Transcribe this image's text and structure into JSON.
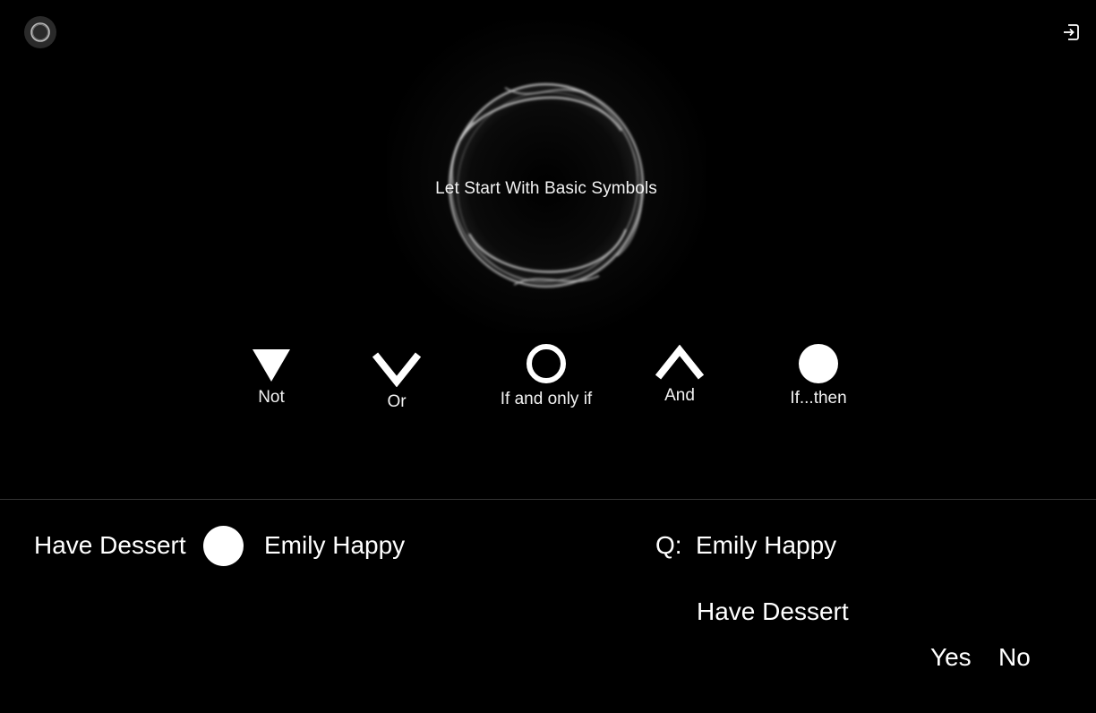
{
  "header": {
    "orb_icon": "orb-avatar-icon",
    "exit_icon": "exit-icon"
  },
  "hero": {
    "title": "Let Start With Basic Symbols"
  },
  "symbols": [
    {
      "label": "Not",
      "icon": "triangle-down-icon"
    },
    {
      "label": "Or",
      "icon": "chevron-down-icon"
    },
    {
      "label": "If and only if",
      "icon": "ring-icon"
    },
    {
      "label": "And",
      "icon": "chevron-up-icon"
    },
    {
      "label": "If...then",
      "icon": "filled-circle-icon"
    }
  ],
  "expression": {
    "left": "Have Dessert",
    "operator_icon": "filled-circle-icon",
    "right": "Emily Happy"
  },
  "question": {
    "prefix": "Q:",
    "line1": "Emily Happy",
    "line2": "Have Dessert",
    "yes_label": "Yes",
    "no_label": "No"
  },
  "colors": {
    "background": "#000000",
    "foreground": "#ffffff",
    "divider": "#333333"
  }
}
